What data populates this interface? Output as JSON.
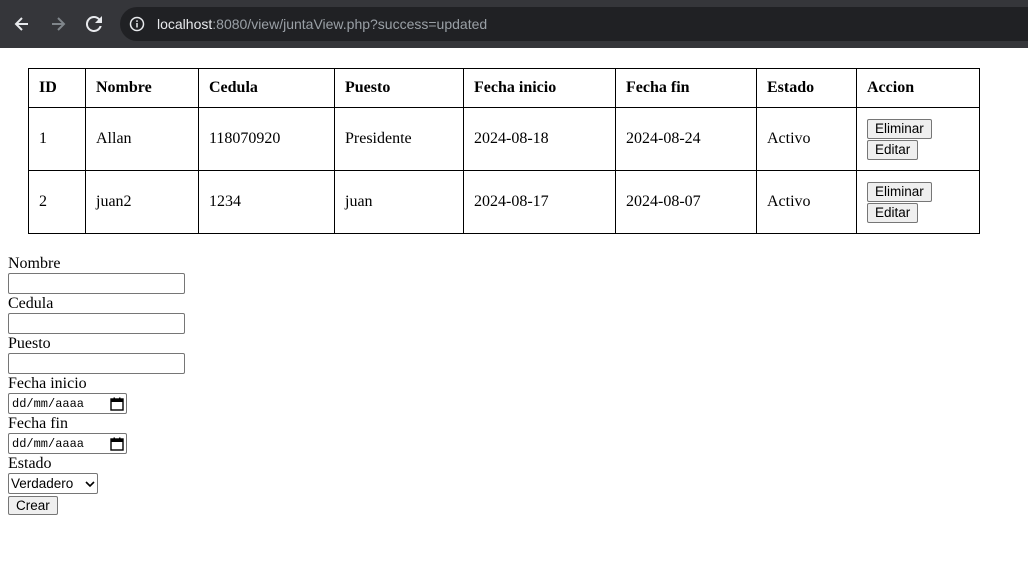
{
  "browser": {
    "url_host": "localhost",
    "url_rest": ":8080/view/juntaView.php?success=updated",
    "icons": {
      "back": "arrow-left-icon",
      "forward": "arrow-right-icon",
      "reload": "reload-icon",
      "info": "info-icon"
    }
  },
  "table": {
    "headers": [
      "ID",
      "Nombre",
      "Cedula",
      "Puesto",
      "Fecha inicio",
      "Fecha fin",
      "Estado",
      "Accion"
    ],
    "rows": [
      {
        "id": "1",
        "nombre": "Allan",
        "cedula": "118070920",
        "puesto": "Presidente",
        "fecha_inicio": "2024-08-18",
        "fecha_fin": "2024-08-24",
        "estado": "Activo"
      },
      {
        "id": "2",
        "nombre": "juan2",
        "cedula": "1234",
        "puesto": "juan",
        "fecha_inicio": "2024-08-17",
        "fecha_fin": "2024-08-07",
        "estado": "Activo"
      }
    ],
    "delete_label": "Eliminar",
    "edit_label": "Editar"
  },
  "form": {
    "nombre_label": "Nombre",
    "cedula_label": "Cedula",
    "puesto_label": "Puesto",
    "fecha_inicio_label": "Fecha inicio",
    "fecha_fin_label": "Fecha fin",
    "date_placeholder": "dd/mm/aaaa",
    "estado_label": "Estado",
    "estado_value": "Verdadero",
    "submit_label": "Crear"
  },
  "colors": {
    "toolbar": "#35363a",
    "omnibox": "#202124",
    "button_bg": "#efefef"
  }
}
